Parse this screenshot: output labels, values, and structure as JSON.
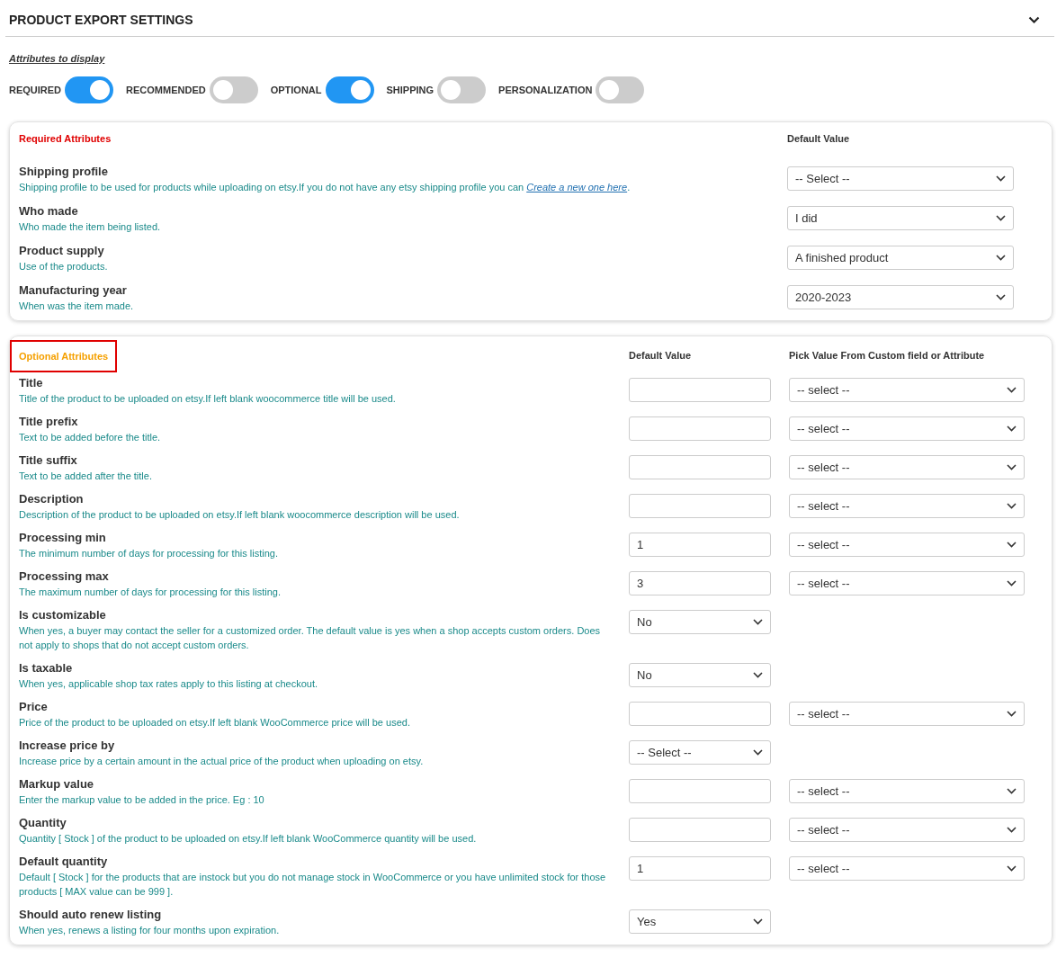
{
  "header": {
    "title": "PRODUCT EXPORT SETTINGS",
    "expanded": true
  },
  "attributes_to_display": {
    "label": "Attributes to display",
    "toggles": [
      {
        "label": "REQUIRED",
        "on": true
      },
      {
        "label": "RECOMMENDED",
        "on": false
      },
      {
        "label": "OPTIONAL",
        "on": true
      },
      {
        "label": "SHIPPING",
        "on": false
      },
      {
        "label": "PERSONALIZATION",
        "on": false
      }
    ]
  },
  "required_section": {
    "title": "Required Attributes",
    "default_header": "Default Value",
    "rows": [
      {
        "label": "Shipping profile",
        "description": "Shipping profile to be used for products while uploading on etsy.If you do not have any etsy shipping profile you can ",
        "link": "Create a new one here",
        "description_end": ".",
        "default": {
          "kind": "select",
          "value": "-- Select --"
        }
      },
      {
        "label": "Who made",
        "description": "Who made the item being listed.",
        "default": {
          "kind": "select",
          "value": "I did"
        }
      },
      {
        "label": "Product supply",
        "description": "Use of the products.",
        "default": {
          "kind": "select",
          "value": "A finished product"
        }
      },
      {
        "label": "Manufacturing year",
        "description": "When was the item made.",
        "default": {
          "kind": "select",
          "value": "2020-2023"
        }
      }
    ]
  },
  "optional_section": {
    "title": "Optional Attributes",
    "highlighted": true,
    "default_header": "Default Value",
    "pick_header": "Pick Value From Custom field or Attribute",
    "rows": [
      {
        "label": "Title",
        "description": "Title of the product to be uploaded on etsy.If left blank woocommerce title will be used.",
        "default": {
          "kind": "input"
        },
        "pick": {
          "kind": "select",
          "value": "-- select --"
        }
      },
      {
        "label": "Title prefix",
        "description": "Text to be added before the title.",
        "default": {
          "kind": "input"
        },
        "pick": {
          "kind": "select",
          "value": "-- select --"
        }
      },
      {
        "label": "Title suffix",
        "description": "Text to be added after the title.",
        "default": {
          "kind": "input"
        },
        "pick": {
          "kind": "select",
          "value": "-- select --"
        }
      },
      {
        "label": "Description",
        "description": "Description of the product to be uploaded on etsy.If left blank woocommerce description will be used.",
        "default": {
          "kind": "input"
        },
        "pick": {
          "kind": "select",
          "value": "-- select --"
        }
      },
      {
        "label": "Processing min",
        "description": "The minimum number of days for processing for this listing.",
        "default": {
          "kind": "input",
          "value": "1"
        },
        "pick": {
          "kind": "select",
          "value": "-- select --"
        }
      },
      {
        "label": "Processing max",
        "description": "The maximum number of days for processing for this listing.",
        "default": {
          "kind": "input",
          "value": "3"
        },
        "pick": {
          "kind": "select",
          "value": "-- select --"
        }
      },
      {
        "label": "Is customizable",
        "description": "When yes, a buyer may contact the seller for a customized order. The default value is yes when a shop accepts custom orders. Does not apply to shops that do not accept custom orders.",
        "default": {
          "kind": "select",
          "value": "No"
        }
      },
      {
        "label": "Is taxable",
        "description": "When yes, applicable shop tax rates apply to this listing at checkout.",
        "default": {
          "kind": "select",
          "value": "No"
        }
      },
      {
        "label": "Price",
        "description": "Price of the product to be uploaded on etsy.If left blank WooCommerce price will be used.",
        "default": {
          "kind": "input"
        },
        "pick": {
          "kind": "select",
          "value": "-- select --"
        }
      },
      {
        "label": "Increase price by",
        "description": "Increase price by a certain amount in the actual price of the product when uploading on etsy.",
        "default": {
          "kind": "select",
          "value": "-- Select --"
        }
      },
      {
        "label": "Markup value",
        "description": "Enter the markup value to be added in the price. Eg : 10",
        "default": {
          "kind": "input"
        },
        "pick": {
          "kind": "select",
          "value": "-- select --"
        }
      },
      {
        "label": "Quantity",
        "description": "Quantity [ Stock ] of the product to be uploaded on etsy.If left blank WooCommerce quantity will be used.",
        "default": {
          "kind": "input"
        },
        "pick": {
          "kind": "select",
          "value": "-- select --"
        }
      },
      {
        "label": "Default quantity",
        "description": "Default [ Stock ] for the products that are instock but you do not manage stock in WooCommerce or you have unlimited stock for those products [ MAX value can be 999 ].",
        "default": {
          "kind": "input",
          "value": "1"
        },
        "pick": {
          "kind": "select",
          "value": "-- select --"
        }
      },
      {
        "label": "Should auto renew listing",
        "description": "When yes, renews a listing for four months upon expiration.",
        "default": {
          "kind": "select",
          "value": "Yes"
        }
      }
    ]
  }
}
